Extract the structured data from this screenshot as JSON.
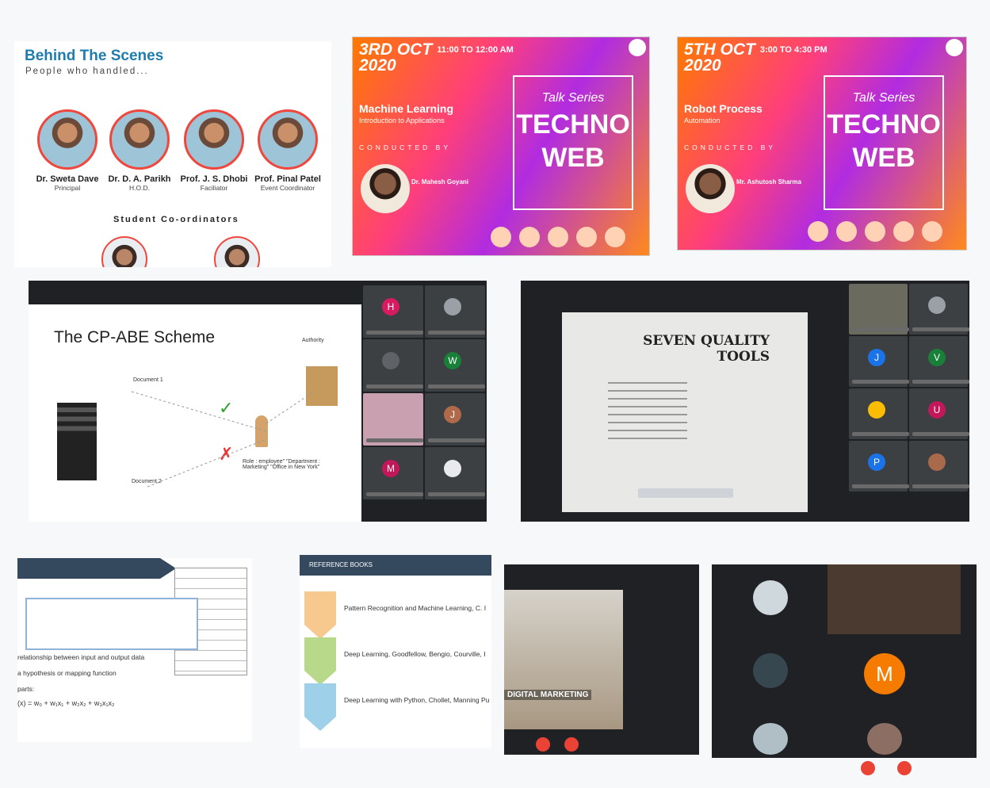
{
  "behind": {
    "title": "Behind The Scenes",
    "subtitle": "People who handled...",
    "people": [
      {
        "name": "Dr. Sweta Dave",
        "role": "Principal"
      },
      {
        "name": "Dr. D. A. Parikh",
        "role": "H.O.D."
      },
      {
        "name": "Prof. J. S. Dhobi",
        "role": "Faciliator"
      },
      {
        "name": "Prof. Pinal Patel",
        "role": "Event Coordinator"
      }
    ],
    "student_heading": "Student Co-ordinators"
  },
  "posters": [
    {
      "date": "3RD OCT",
      "year": "2020",
      "time": "11:00 TO 12:00 AM",
      "topic": "Machine Learning",
      "subtopic": "Introduction to Applications",
      "conducted": "CONDUCTED BY",
      "series": "Talk Series",
      "brand1": "TECHNO",
      "brand2": "WEB",
      "speaker": "Dr. Mahesh Goyani"
    },
    {
      "date": "5TH OCT",
      "year": "2020",
      "time": "3:00 TO 4:30 PM",
      "topic": "Robot Process",
      "subtopic": "Automation",
      "conducted": "CONDUCTED BY",
      "series": "Talk Series",
      "brand1": "TECHNO",
      "brand2": "WEB",
      "speaker": "Mr. Ashutosh Sharma"
    }
  ],
  "meeting1": {
    "slide_title": "The CP-ABE Scheme",
    "labels": {
      "authority": "Authority",
      "doc1": "Document 1",
      "doc2": "Document 2",
      "attrs": "Role : employee\" \"Department : Marketing\" \"Office in New York\""
    },
    "tiles": [
      "H",
      "W",
      "J",
      "M"
    ]
  },
  "meeting2": {
    "slide_title_1": "SEVEN QUALITY",
    "slide_title_2": "TOOLS",
    "tiles": [
      "J",
      "V",
      "U",
      "P"
    ]
  },
  "shots": {
    "ml_text_1": "relationship between input and output data",
    "ml_text_2": "a hypothesis or mapping function",
    "ml_text_3": "parts:",
    "ml_formula": "(x) = w₀ + w₁x₁ + w₂x₂ + w₃x₁x₂",
    "ref_header": "REFERENCE BOOKS",
    "ref_items": [
      "Pattern Recognition and Machine Learning, C. I",
      "Deep Learning, Goodfellow, Bengio, Courville, I",
      "Deep Learning with Python, Chollet, Manning Pu"
    ],
    "dm_banner": "DIGITAL MARKETING",
    "tile_m": "M"
  },
  "colors": {
    "accent": "#1f7cae",
    "red": "#ea4335",
    "meet_bg": "#202124"
  }
}
